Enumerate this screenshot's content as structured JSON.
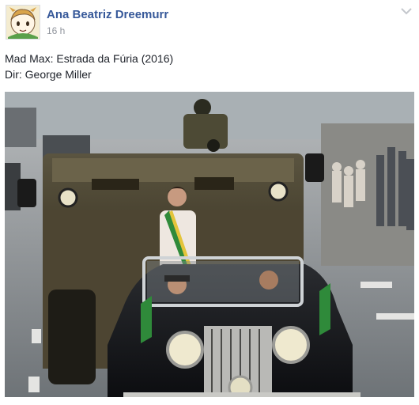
{
  "post": {
    "author_name": "Ana Beatriz Dreemurr",
    "timestamp": "16 h",
    "text_lines": [
      "Mad Max: Estrada da Fúria (2016)",
      "Dir: George Miller"
    ],
    "avatar_icon": "cartoon-avatar-icon",
    "menu_icon": "chevron-down-icon",
    "photo_subject": "photo"
  },
  "colors": {
    "author_link": "#365899",
    "timestamp": "#90949c",
    "body_text": "#1d2129"
  }
}
